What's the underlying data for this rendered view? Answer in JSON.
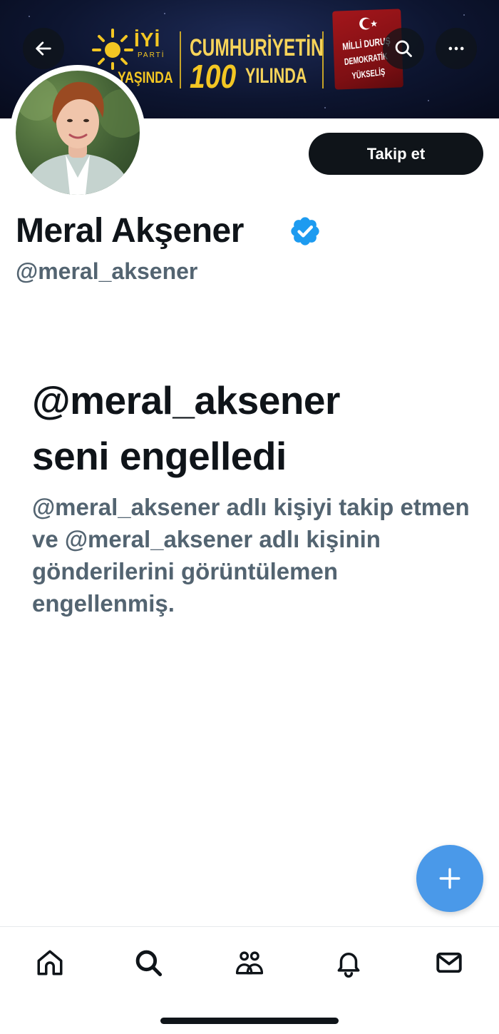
{
  "banner": {
    "logo_word": "İYİ",
    "logo_sub": "PARTİ",
    "years_partial": "YAŞINDA",
    "cumhuriyet": "CUMHURİYETİN",
    "hundred": "100",
    "yilinda": "YILINDA",
    "flag_line1": "MİLLİ DURUŞ",
    "flag_line2": "DEMOKRATİK",
    "flag_line3": "YÜKSELİŞ"
  },
  "header": {
    "back_icon": "arrow-left-icon",
    "search_icon": "search-icon",
    "more_icon": "more-horizontal-icon"
  },
  "profile": {
    "display_name": "Meral Akşener",
    "handle": "@meral_aksener",
    "verified_icon": "verified-badge-icon",
    "verified_color": "#1d9bf0",
    "follow_label": "Takip et"
  },
  "blocked": {
    "title_line1": "@meral_aksener",
    "title_line2": "seni engelledi",
    "description": "@meral_aksener adlı kişiyi takip etmen ve @meral_aksener adlı kişinin gönderilerini görüntülemen engellenmiş."
  },
  "fab": {
    "icon": "plus-icon",
    "color": "#4a99e9"
  },
  "nav": [
    {
      "icon": "home-icon"
    },
    {
      "icon": "search-icon"
    },
    {
      "icon": "communities-icon"
    },
    {
      "icon": "notifications-icon"
    },
    {
      "icon": "messages-icon"
    }
  ]
}
